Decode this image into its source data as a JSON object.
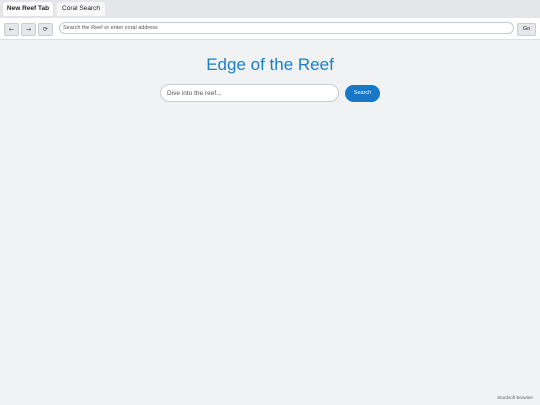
{
  "tabs": [
    {
      "label": "New Reef Tab",
      "active": true
    },
    {
      "label": "Coral Search",
      "active": false
    }
  ],
  "nav": {
    "back_icon": "←",
    "forward_icon": "→",
    "reload_icon": "⟳",
    "address_placeholder": "Search the Reef or enter coral address",
    "go_label": "Go"
  },
  "main": {
    "title": "Edge of the Reef",
    "search_placeholder": "Dive into the reef...",
    "search_label": "Search"
  },
  "footer": {
    "text": "Sturdsoft Browser"
  },
  "colors": {
    "accent": "#1877c9",
    "title": "#1c7fc4",
    "background": "#f0f2f4"
  }
}
